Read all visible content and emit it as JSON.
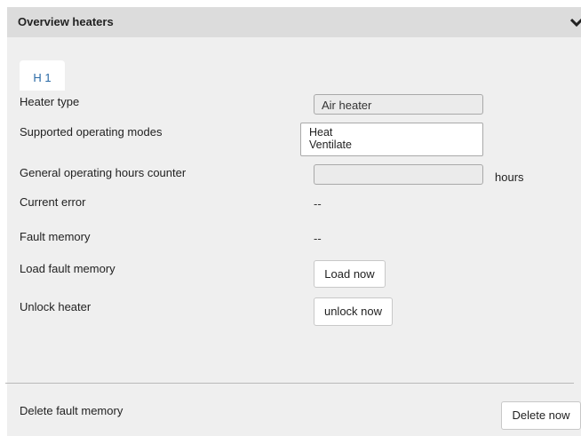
{
  "panel": {
    "title": "Overview heaters",
    "collapse_icon": "chevron-down-icon"
  },
  "tabs": [
    {
      "label": "H 1",
      "active": true
    }
  ],
  "rows": {
    "heater_type": {
      "label": "Heater type",
      "value": "Air heater"
    },
    "supported_modes": {
      "label": "Supported operating modes",
      "options": [
        "Heat",
        "Ventilate"
      ]
    },
    "hours_counter": {
      "label": "General operating hours counter",
      "value": "",
      "unit": "hours"
    },
    "current_error": {
      "label": "Current error",
      "value": "--"
    },
    "fault_memory": {
      "label": "Fault memory",
      "value": "--"
    },
    "load_fault_memory": {
      "label": "Load fault memory",
      "button": "Load now"
    },
    "unlock_heater": {
      "label": "Unlock heater",
      "button": "unlock now"
    },
    "delete_fault_memory": {
      "label": "Delete fault memory",
      "button": "Delete now"
    }
  },
  "colors": {
    "header_bg": "#dcdcdc",
    "panel_bg": "#efefef",
    "tab_text": "#2a6aa6"
  }
}
